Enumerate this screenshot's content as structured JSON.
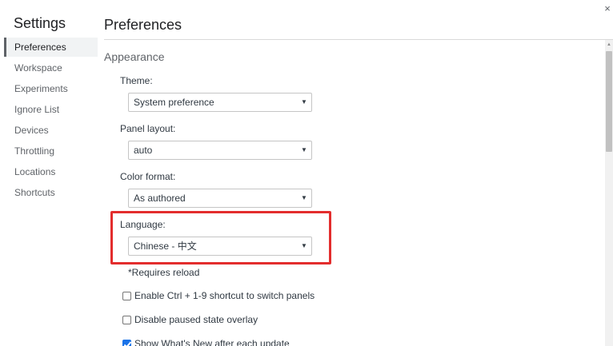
{
  "sidebar": {
    "title": "Settings",
    "items": [
      {
        "label": "Preferences",
        "active": true
      },
      {
        "label": "Workspace"
      },
      {
        "label": "Experiments"
      },
      {
        "label": "Ignore List"
      },
      {
        "label": "Devices"
      },
      {
        "label": "Throttling"
      },
      {
        "label": "Locations"
      },
      {
        "label": "Shortcuts"
      }
    ]
  },
  "main": {
    "title": "Preferences",
    "close_icon": "×",
    "section": "Appearance",
    "fields": {
      "theme": {
        "label": "Theme:",
        "value": "System preference"
      },
      "panel_layout": {
        "label": "Panel layout:",
        "value": "auto"
      },
      "color_format": {
        "label": "Color format:",
        "value": "As authored"
      },
      "language": {
        "label": "Language:",
        "value": "Chinese - 中文"
      }
    },
    "reload_note": "*Requires reload",
    "checkboxes": [
      {
        "label": "Enable Ctrl + 1-9 shortcut to switch panels",
        "checked": false
      },
      {
        "label": "Disable paused state overlay",
        "checked": false
      },
      {
        "label": "Show What's New after each update",
        "checked": true
      }
    ]
  },
  "icons": {
    "dropdown": "chevron-down-icon",
    "close": "close-icon"
  },
  "colors": {
    "highlight": "#e32d2d",
    "checkbox_checked": "#1a73e8"
  }
}
